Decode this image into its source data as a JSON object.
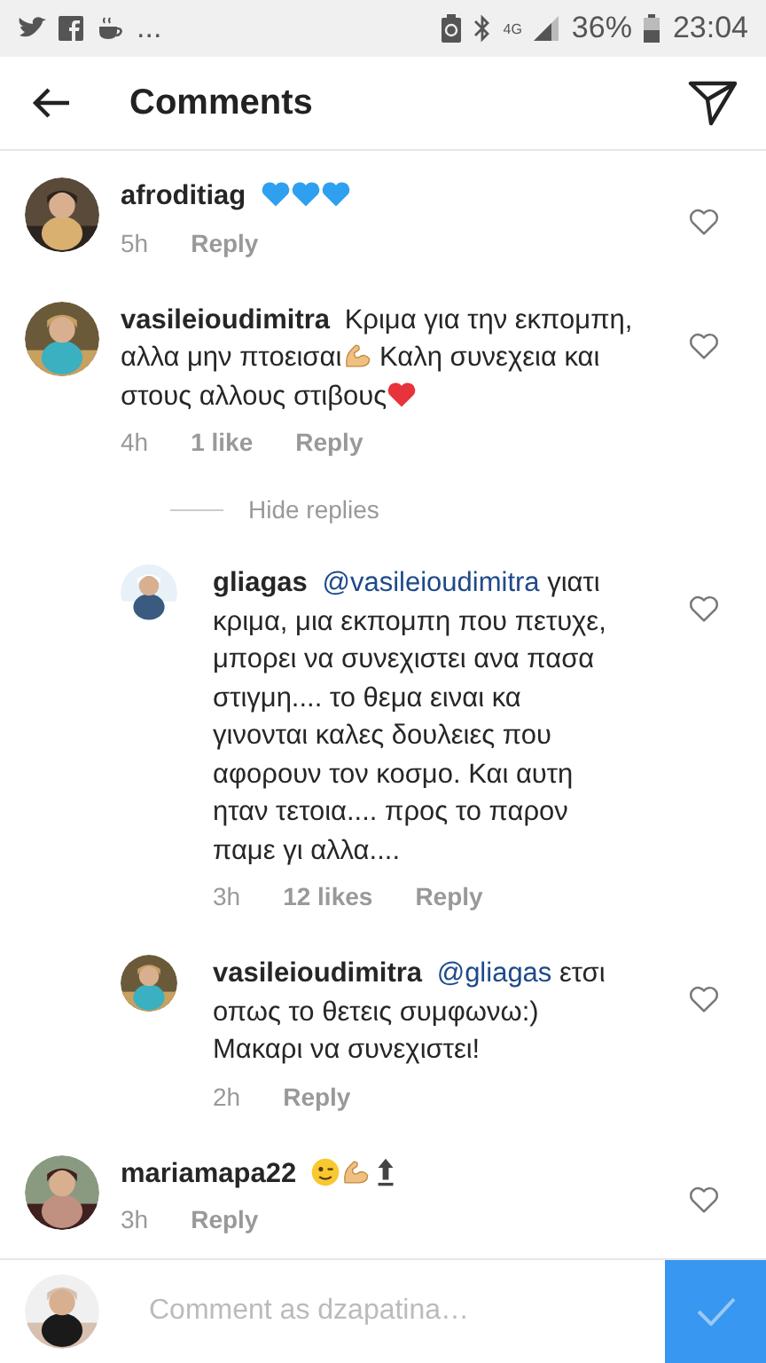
{
  "status_bar": {
    "more": "...",
    "network": "4G",
    "battery": "36%",
    "time": "23:04"
  },
  "header": {
    "title": "Comments"
  },
  "comments": [
    {
      "user": "afroditiag",
      "body": [
        {
          "kind": "blue_heart"
        },
        {
          "kind": "blue_heart"
        },
        {
          "kind": "blue_heart"
        }
      ],
      "time": "5h",
      "reply": "Reply"
    },
    {
      "user": "vasileioudimitra",
      "body": [
        {
          "kind": "text",
          "text": "Κριμα για την εκπομπη, αλλα μην πτοεισαι"
        },
        {
          "kind": "flexed_arm"
        },
        {
          "kind": "text",
          "text": " Καλη συνεχεια και στους αλλους στιβους"
        },
        {
          "kind": "red_heart"
        }
      ],
      "time": "4h",
      "likes": "1 like",
      "reply": "Reply",
      "replies_toggle": "Hide replies",
      "children": [
        {
          "user": "gliagas",
          "body": [
            {
              "kind": "mention",
              "text": "@vasileioudimitra"
            },
            {
              "kind": "text",
              "text": " γιατι κριμα, μια εκπομπη που πετυχε, μπορει να συνεχιστει ανα πασα στιγμη.... το θεμα ειναι κα γινονται καλες δουλειες που αφορουν τον κοσμο. Και αυτη ηταν τετοια.... προς το παρον παμε γι αλλα...."
            }
          ],
          "time": "3h",
          "likes": "12 likes",
          "reply": "Reply"
        },
        {
          "user": "vasileioudimitra",
          "body": [
            {
              "kind": "mention",
              "text": "@gliagas"
            },
            {
              "kind": "text",
              "text": " ετσι οπως το θετεις συμφωνω:) Μακαρι να συνεχιστει!"
            }
          ],
          "time": "2h",
          "reply": "Reply"
        }
      ]
    },
    {
      "user": "mariamapa22",
      "body": [
        {
          "kind": "wink_face"
        },
        {
          "kind": "flexed_arm"
        },
        {
          "kind": "top_arrow"
        }
      ],
      "time": "3h",
      "reply": "Reply"
    }
  ],
  "composer": {
    "placeholder": "Comment as dzapatina…"
  }
}
